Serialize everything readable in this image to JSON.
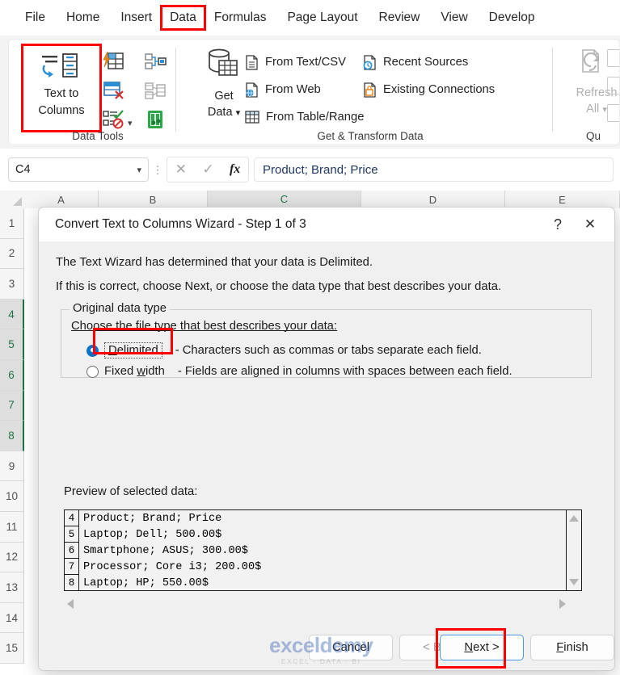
{
  "ribbon": {
    "tabs": [
      {
        "label": "File",
        "highlight": false
      },
      {
        "label": "Home",
        "highlight": false
      },
      {
        "label": "Insert",
        "highlight": false
      },
      {
        "label": "Data",
        "highlight": true
      },
      {
        "label": "Formulas",
        "highlight": false
      },
      {
        "label": "Page Layout",
        "highlight": false
      },
      {
        "label": "Review",
        "highlight": false
      },
      {
        "label": "View",
        "highlight": false
      },
      {
        "label": "Develop",
        "highlight": false
      }
    ],
    "groups": {
      "data_tools": {
        "label": "Data Tools",
        "text_to_columns": "Text to\nColumns",
        "text_to_columns_line1": "Text to",
        "text_to_columns_line2": "Columns"
      },
      "get_transform": {
        "label": "Get & Transform Data",
        "get_data_line1": "Get",
        "get_data_line2": "Data",
        "items": [
          "From Text/CSV",
          "From Web",
          "From Table/Range",
          "Recent Sources",
          "Existing Connections"
        ]
      },
      "queries": {
        "label": "Qu",
        "refresh_line1": "Refresh",
        "refresh_line2": "All"
      }
    }
  },
  "formula_bar": {
    "name_box_value": "C4",
    "cancel_icon": "✕",
    "confirm_icon": "✓",
    "fx_label": "fx",
    "formula_value": "Product; Brand; Price"
  },
  "grid": {
    "column_headers": [
      "A",
      "B",
      "C",
      "D",
      "E"
    ],
    "selected_column": "C",
    "row_headers": [
      "1",
      "2",
      "3",
      "4",
      "5",
      "6",
      "7",
      "8",
      "9",
      "10",
      "11",
      "12",
      "13",
      "14",
      "15"
    ],
    "selected_rows": [
      "4",
      "5",
      "6",
      "7",
      "8"
    ]
  },
  "dialog": {
    "title": "Convert Text to Columns Wizard - Step 1 of 3",
    "help_icon": "?",
    "close_icon": "✕",
    "line1": "The Text Wizard has determined that your data is Delimited.",
    "line2": "If this is correct, choose Next, or choose the data type that best describes your data.",
    "groupbox_title": "Original data type",
    "choose_label": "Choose the file type that best describes your data:",
    "options": [
      {
        "id": "delimited",
        "label": "Delimited",
        "accel": "D",
        "selected": true,
        "description": "- Characters such as commas or tabs separate each field."
      },
      {
        "id": "fixed-width",
        "label": "Fixed width",
        "accel": "w",
        "selected": false,
        "description": "- Fields are aligned in columns with spaces between each field."
      }
    ],
    "preview_label": "Preview of selected data:",
    "preview_rows": [
      {
        "num": "4",
        "text": "Product; Brand; Price"
      },
      {
        "num": "5",
        "text": "Laptop; Dell; 500.00$"
      },
      {
        "num": "6",
        "text": "Smartphone; ASUS; 300.00$"
      },
      {
        "num": "7",
        "text": "Processor; Core i3; 200.00$"
      },
      {
        "num": "8",
        "text": "Laptop; HP; 550.00$"
      }
    ],
    "buttons": {
      "cancel": "Cancel",
      "back": "< Back",
      "next": "Next >",
      "next_accel": "N",
      "finish": "Finish",
      "finish_accel": "F"
    }
  },
  "watermark": {
    "main": "exceldemy",
    "sub": "EXCEL - DATA - BI"
  },
  "colors": {
    "accent_red": "#ff0000",
    "excel_green": "#217346",
    "focus_blue": "#4a9ae0",
    "radio_blue": "#0a70c8",
    "formula_text": "#1f3864"
  }
}
